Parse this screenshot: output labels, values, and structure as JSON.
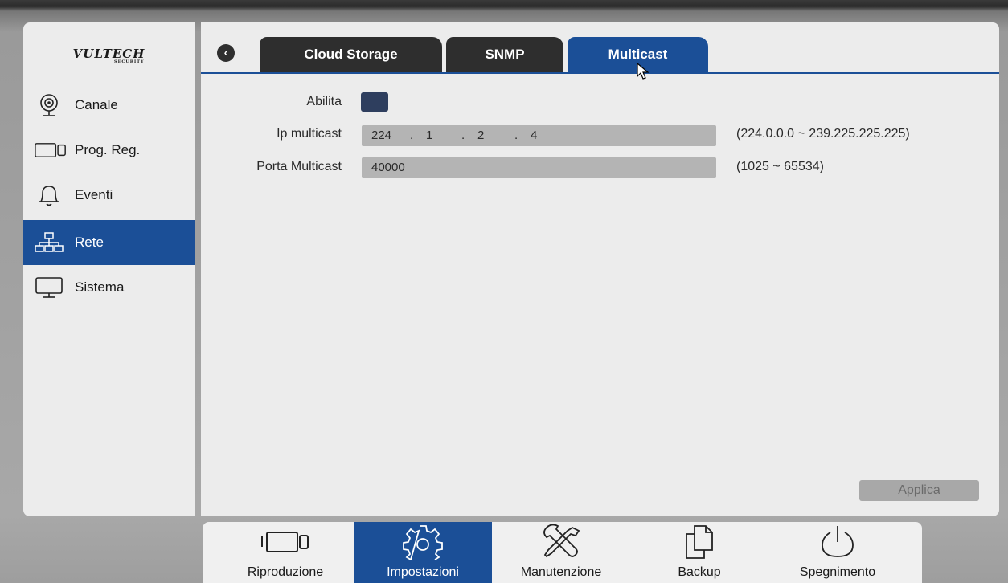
{
  "brand": {
    "logo": "VULTECH",
    "tagline": "SECURITY"
  },
  "sidebar": {
    "items": [
      {
        "label": "Canale",
        "icon": "camera-icon"
      },
      {
        "label": "Prog. Reg.",
        "icon": "record-schedule-icon"
      },
      {
        "label": "Eventi",
        "icon": "bell-icon"
      },
      {
        "label": "Rete",
        "icon": "network-icon",
        "active": true
      },
      {
        "label": "Sistema",
        "icon": "monitor-icon"
      }
    ]
  },
  "tabs": [
    {
      "label": "Cloud Storage"
    },
    {
      "label": "SNMP"
    },
    {
      "label": "Multicast",
      "active": true
    }
  ],
  "form": {
    "enable_label": "Abilita",
    "enable_checked": true,
    "ip_label": "Ip multicast",
    "ip_segments": [
      "224",
      "1",
      "2",
      "4"
    ],
    "ip_separator": ".",
    "ip_range": "(224.0.0.0 ~ 239.225.225.225)",
    "port_label": "Porta Multicast",
    "port_value": "40000",
    "port_range": "(1025 ~ 65534)"
  },
  "apply_label": "Applica",
  "dock": {
    "items": [
      {
        "label": "Riproduzione",
        "icon": "playback-camera-icon"
      },
      {
        "label": "Impostazioni",
        "icon": "gear-icon",
        "active": true
      },
      {
        "label": "Manutenzione",
        "icon": "tools-icon"
      },
      {
        "label": "Backup",
        "icon": "copy-files-icon"
      },
      {
        "label": "Spegnimento",
        "icon": "power-icon"
      }
    ]
  },
  "colors": {
    "accent": "#1b4f97",
    "tab_dark": "#2e2e2e",
    "panel": "#ececec",
    "field": "#b4b4b4"
  }
}
